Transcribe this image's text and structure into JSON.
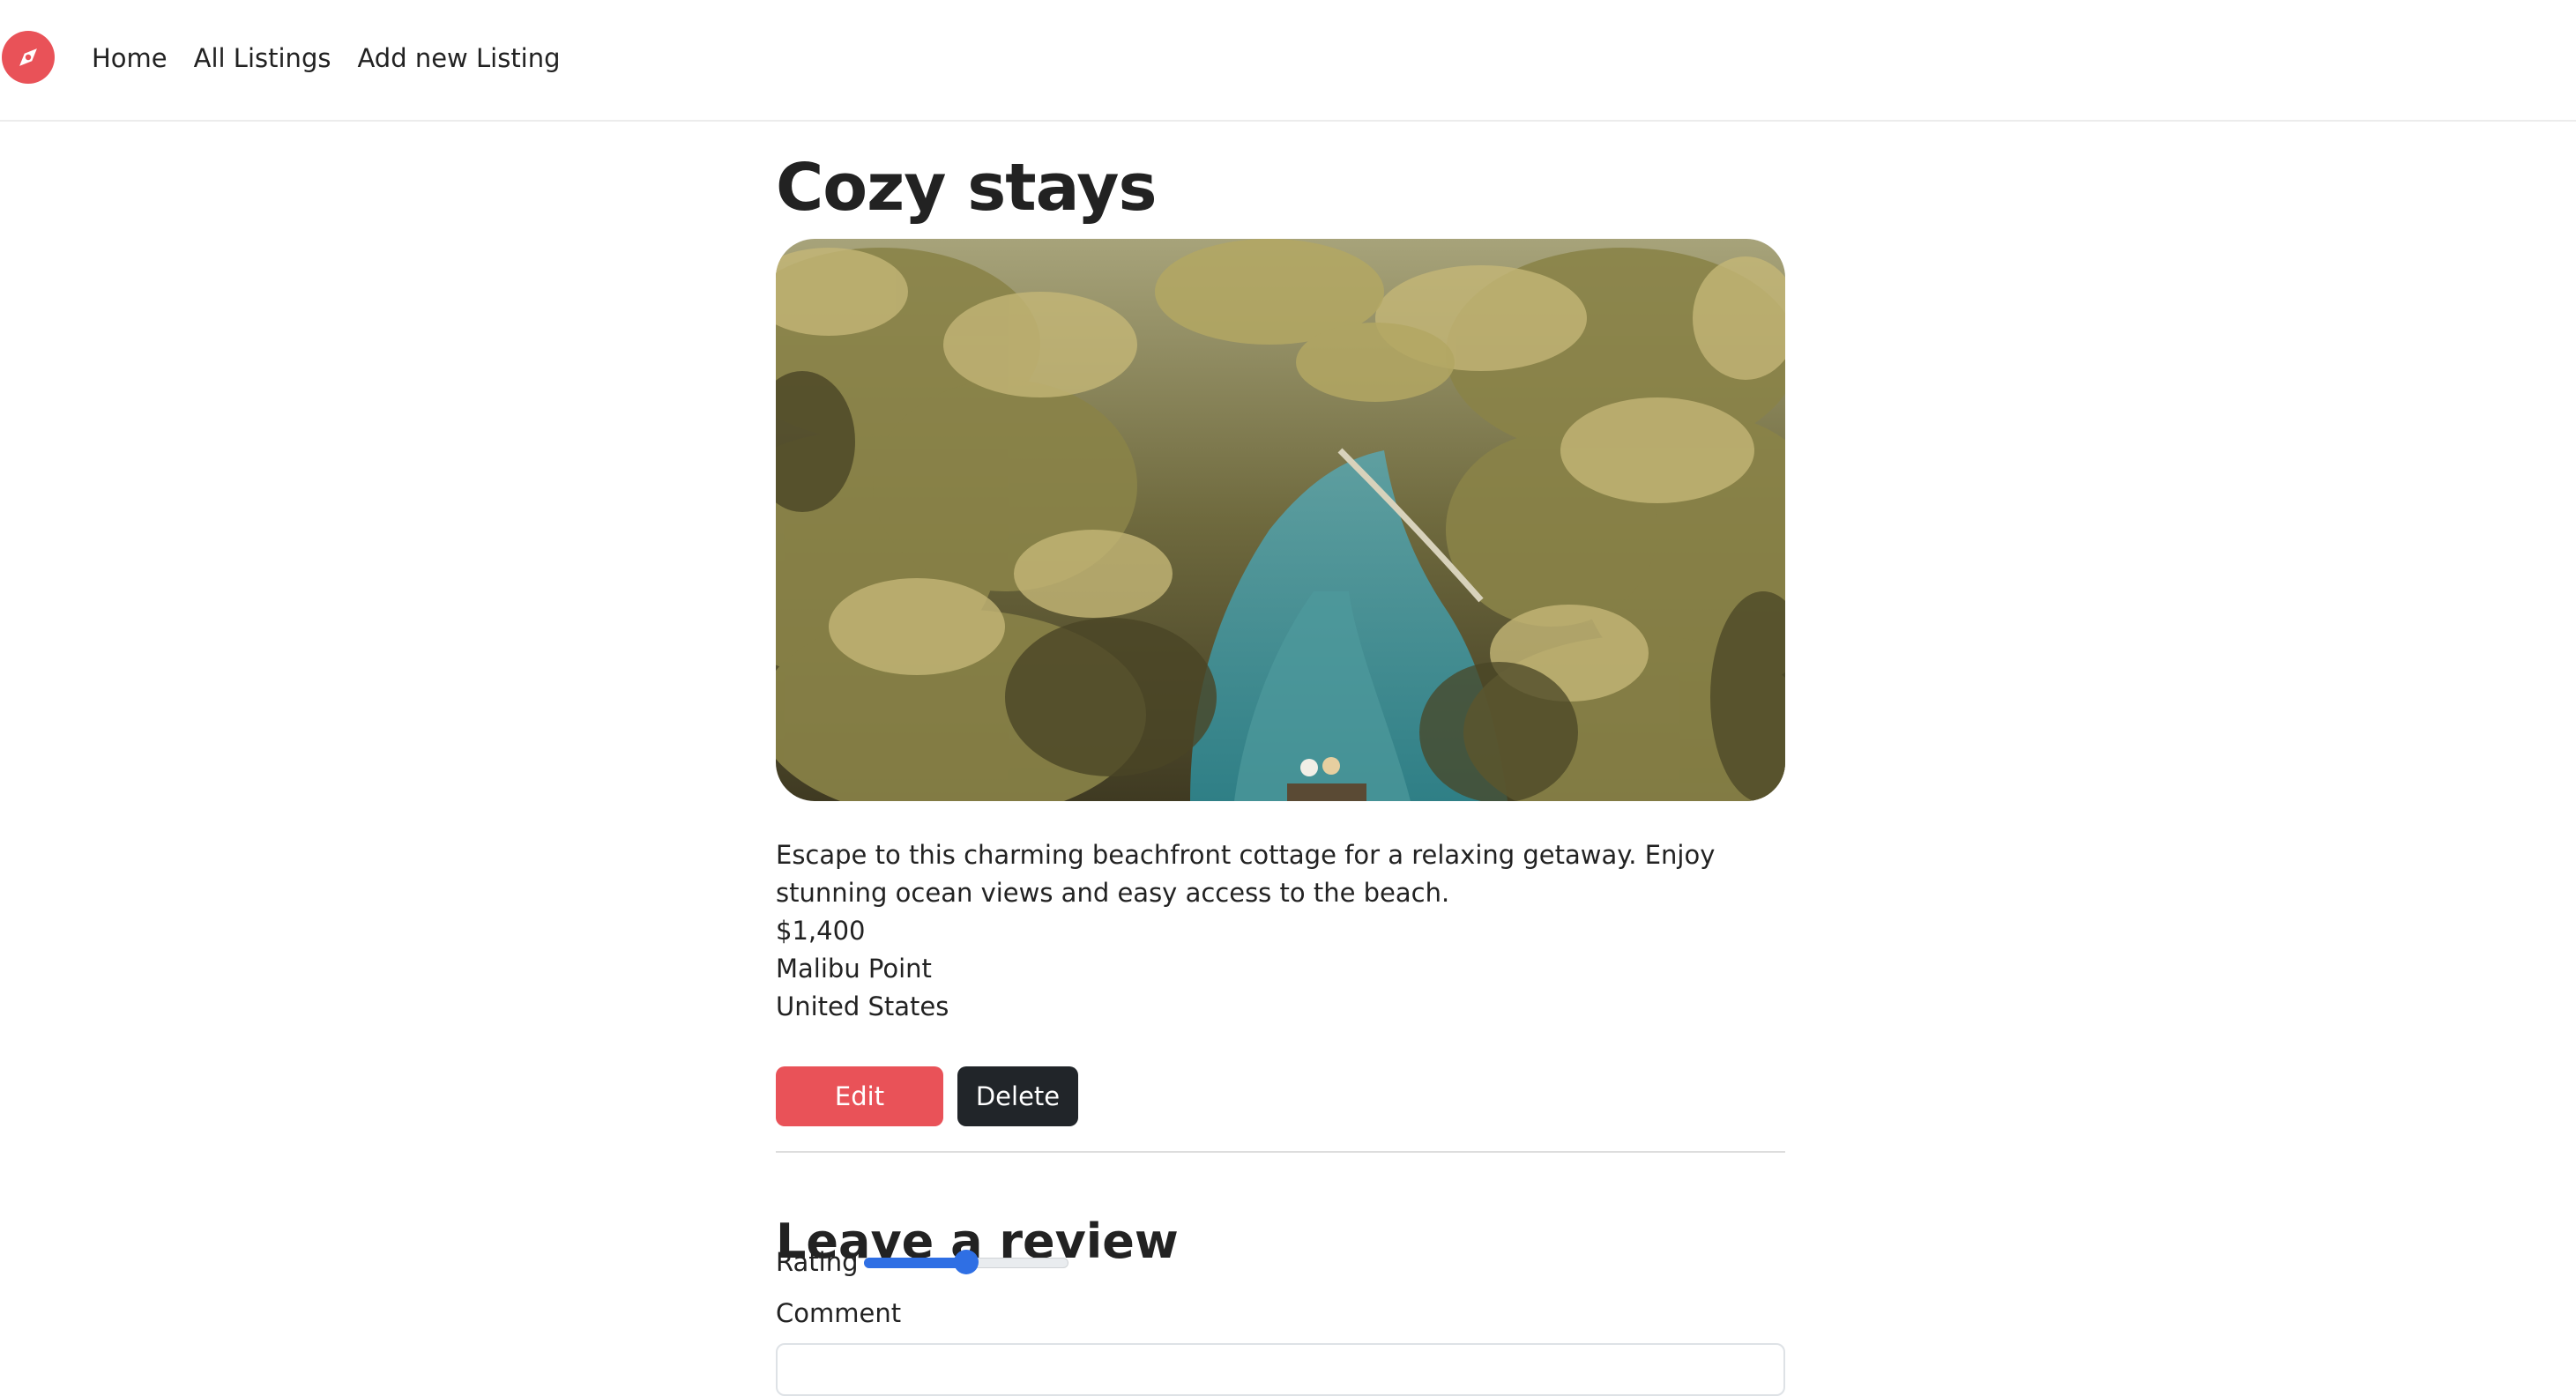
{
  "nav": {
    "brand_icon": "compass-icon",
    "brand_color": "#e95258",
    "links": [
      "Home",
      "All Listings",
      "Add new Listing"
    ]
  },
  "listing": {
    "title": "Cozy stays",
    "image_alt": "tropical river with palm trees",
    "description": "Escape to this charming beachfront cottage for a relaxing getaway. Enjoy stunning ocean views and easy access to the beach.",
    "price": "$1,400",
    "location": "Malibu Point",
    "country": "United States"
  },
  "actions": {
    "edit_label": "Edit",
    "delete_label": "Delete",
    "edit_color": "#e95258",
    "delete_color": "#212529"
  },
  "review": {
    "heading": "Leave a review",
    "rating_label": "Rating",
    "rating_value_fraction": 0.5,
    "comment_label": "Comment",
    "comment_value": ""
  }
}
